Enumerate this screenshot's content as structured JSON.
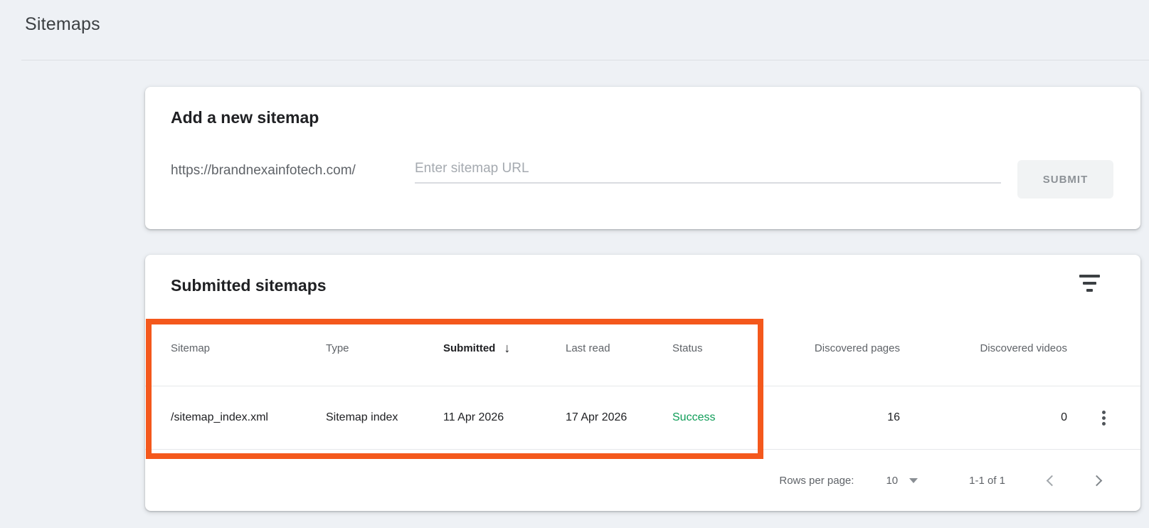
{
  "page": {
    "title": "Sitemaps"
  },
  "add_card": {
    "heading": "Add a new sitemap",
    "url_prefix": "https://brandnexainfotech.com/",
    "input_placeholder": "Enter sitemap URL",
    "input_value": "",
    "submit_label": "SUBMIT"
  },
  "table_card": {
    "heading": "Submitted sitemaps",
    "columns": [
      "Sitemap",
      "Type",
      "Submitted",
      "Last read",
      "Status",
      "Discovered pages",
      "Discovered videos"
    ],
    "sort": {
      "column": "Submitted",
      "direction": "desc",
      "arrow": "↓"
    },
    "rows": [
      {
        "sitemap": "/sitemap_index.xml",
        "type": "Sitemap index",
        "submitted": "11 Apr 2026",
        "last_read": "17 Apr 2026",
        "status": "Success",
        "discovered_pages": "16",
        "discovered_videos": "0"
      }
    ],
    "pagination": {
      "rows_per_page_label": "Rows per page:",
      "rows_per_page_value": "10",
      "range_label": "1-1 of 1"
    }
  },
  "annotation": {
    "type": "highlight-box",
    "color": "#f4581c",
    "covers": "Sitemap, Type, Submitted, Last read and Status columns of header and first row"
  },
  "colors": {
    "page_background": "#eef1f5",
    "card_background": "#ffffff",
    "success_text": "#0f9d58",
    "muted_text": "#5f6368",
    "annotation_orange": "#f4581c"
  }
}
